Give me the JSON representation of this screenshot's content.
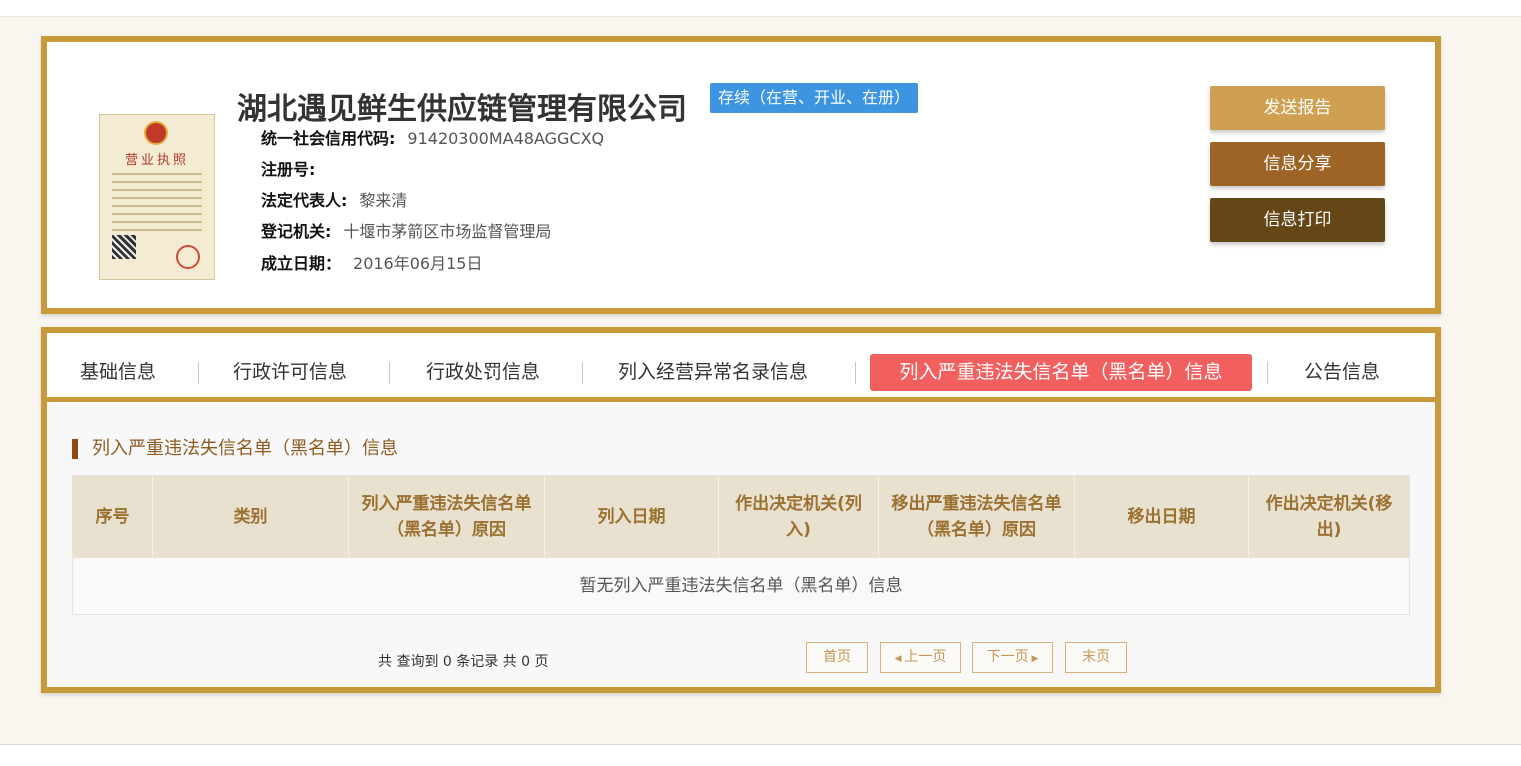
{
  "company": {
    "name": "湖北遇见鲜生供应链管理有限公司",
    "status": "存续（在营、开业、在册）",
    "license_title": "营业执照",
    "fields": [
      {
        "label": "统一社会信用代码:",
        "value": "91420300MA48AGGCXQ"
      },
      {
        "label": "注册号:",
        "value": ""
      },
      {
        "label": "法定代表人:",
        "value": "黎来清"
      },
      {
        "label": "登记机关:",
        "value": "十堰市茅箭区市场监督管理局"
      },
      {
        "label": "成立日期：",
        "value": "2016年06月15日"
      }
    ]
  },
  "actions": {
    "send_report": "发送报告",
    "share": "信息分享",
    "print": "信息打印"
  },
  "tabs": [
    {
      "label": "基础信息",
      "active": false
    },
    {
      "label": "行政许可信息",
      "active": false
    },
    {
      "label": "行政处罚信息",
      "active": false
    },
    {
      "label": "列入经营异常名录信息",
      "active": false
    },
    {
      "label": "列入严重违法失信名单（黑名单）信息",
      "active": true
    },
    {
      "label": "公告信息",
      "active": false
    }
  ],
  "section": {
    "title": "列入严重违法失信名单（黑名单）信息"
  },
  "table": {
    "columns": [
      "序号",
      "类别",
      "列入严重违法失信名单（黑名单）原因",
      "列入日期",
      "作出决定机关(列入)",
      "移出严重违法失信名单（黑名单）原因",
      "移出日期",
      "作出决定机关(移出)"
    ],
    "empty_text": "暂无列入严重违法失信名单（黑名单）信息"
  },
  "pagination": {
    "summary": "共 查询到 0 条记录 共 0 页",
    "first": "首页",
    "prev": "上一页",
    "next": "下一页",
    "last": "末页"
  },
  "colors": {
    "frame": "#c99a3a",
    "status_badge": "#3d95e2",
    "active_tab": "#f25f5f",
    "send_report_button": "#cfa051",
    "share_button": "#9d6426",
    "print_button": "#654617"
  }
}
